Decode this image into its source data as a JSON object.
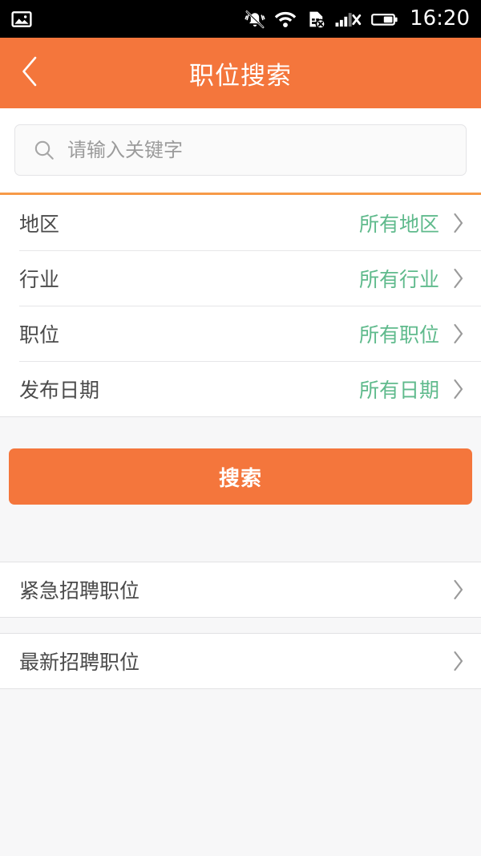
{
  "statusbar": {
    "time": "16:20",
    "icons": {
      "left": [
        "image-icon"
      ],
      "right": [
        "vibrate-off-icon",
        "wifi-icon",
        "sim-card-off-icon",
        "signal-off-icon",
        "battery-icon"
      ]
    }
  },
  "header": {
    "title": "职位搜索",
    "back_icon": "chevron-left-icon",
    "background_color": "#f4763c"
  },
  "search": {
    "value": "",
    "placeholder": "请输入关键字",
    "icon": "search-icon"
  },
  "filters": {
    "rows": [
      {
        "label": "地区",
        "value": "所有地区",
        "chevron": "chevron-right-icon"
      },
      {
        "label": "行业",
        "value": "所有行业",
        "chevron": "chevron-right-icon"
      },
      {
        "label": "职位",
        "value": "所有职位",
        "chevron": "chevron-right-icon"
      },
      {
        "label": "发布日期",
        "value": "所有日期",
        "chevron": "chevron-right-icon"
      }
    ],
    "value_color": "#5fba8c"
  },
  "action": {
    "search_label": "搜索",
    "button_color": "#f4763c"
  },
  "shortcuts": {
    "rows": [
      {
        "label": "紧急招聘职位",
        "chevron": "chevron-right-icon"
      },
      {
        "label": "最新招聘职位",
        "chevron": "chevron-right-icon"
      }
    ]
  }
}
